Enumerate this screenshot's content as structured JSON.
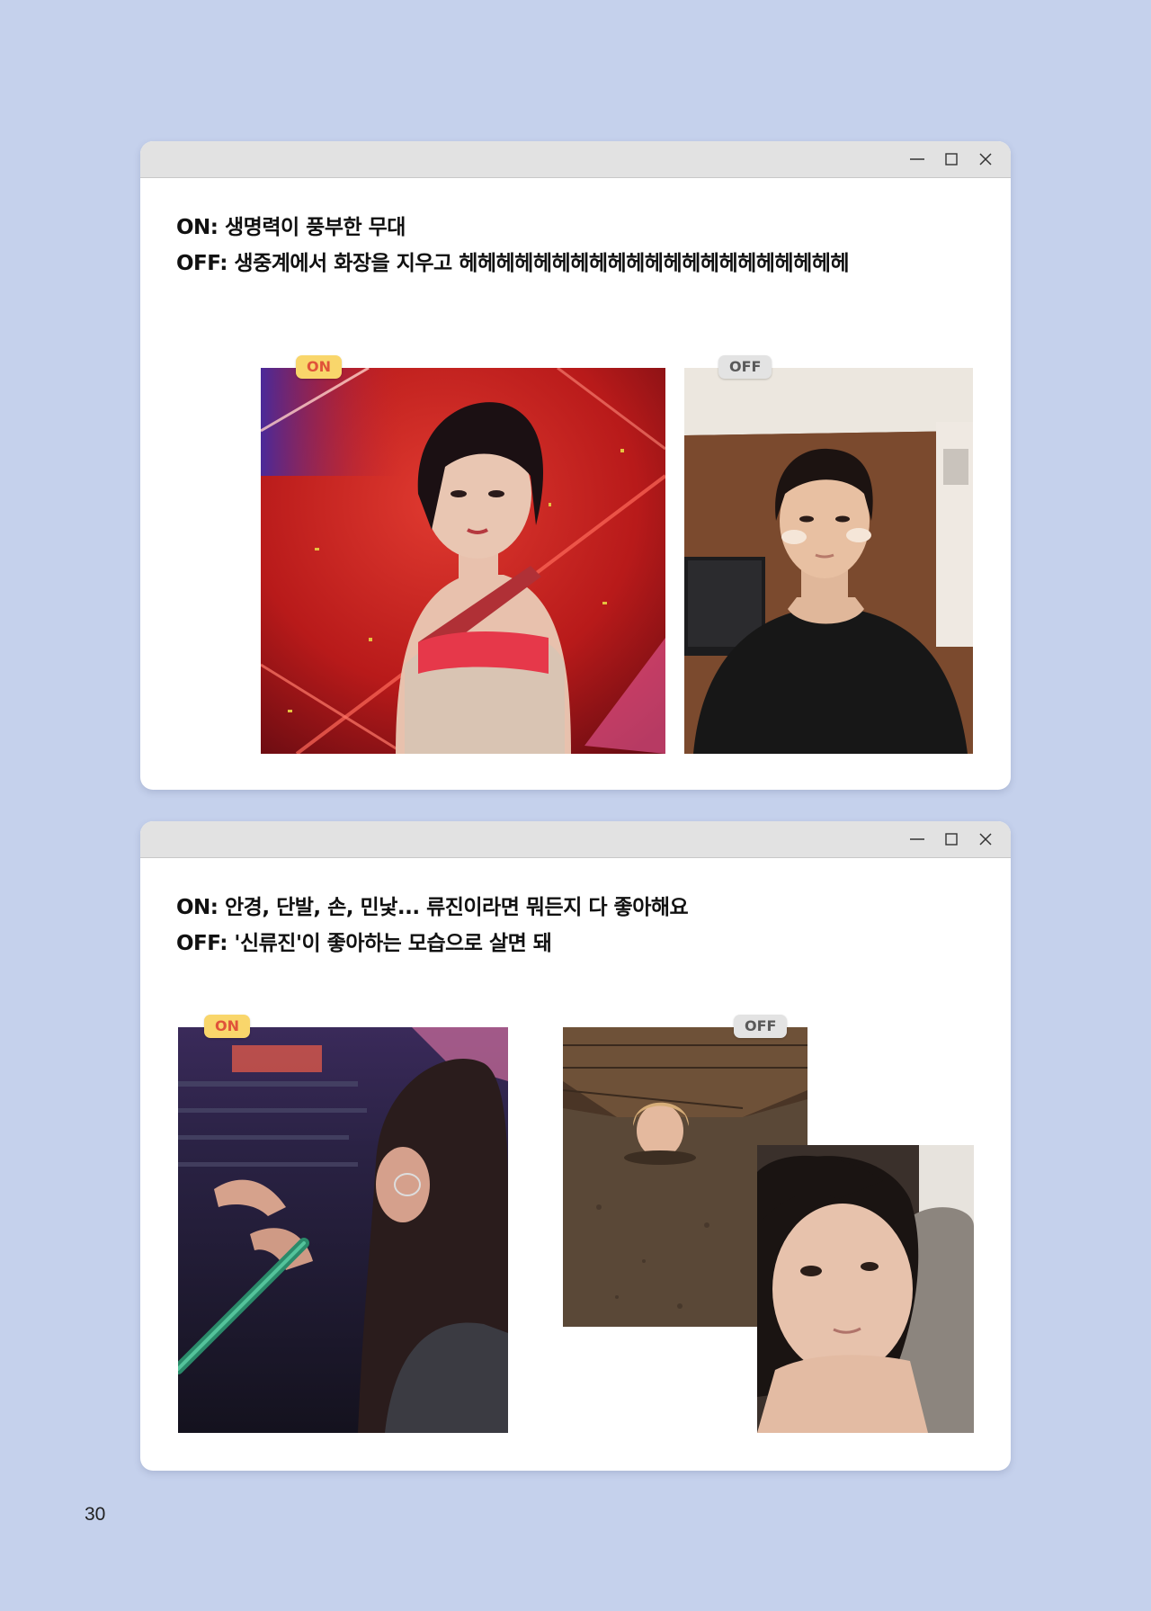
{
  "windows": [
    {
      "caption": {
        "line1": "ON: 생명력이 풍부한 무대",
        "line2": "OFF: 생중계에서 화장을 지우고 헤헤헤헤헤헤헤헤헤헤헤헤헤헤헤헤헤헤헤헤헤"
      },
      "on_badge": "ON",
      "off_badge": "OFF"
    },
    {
      "caption": {
        "line1": "ON: 안경, 단발, 손, 민낯... 류진이라면 뭐든지 다 좋아해요",
        "line2": "OFF: '신류진'이 좋아하는 모습으로 살면 돼"
      },
      "on_badge": "ON",
      "off_badge": "OFF"
    }
  ],
  "page_number": "30",
  "colors": {
    "page_background": "#c5d1ec",
    "titlebar": "#e2e2e2",
    "on_badge_bg": "#f9d66b",
    "on_badge_text": "#e0533a",
    "off_badge_bg": "#e3e3e3",
    "off_badge_text": "#5a5a5a"
  }
}
